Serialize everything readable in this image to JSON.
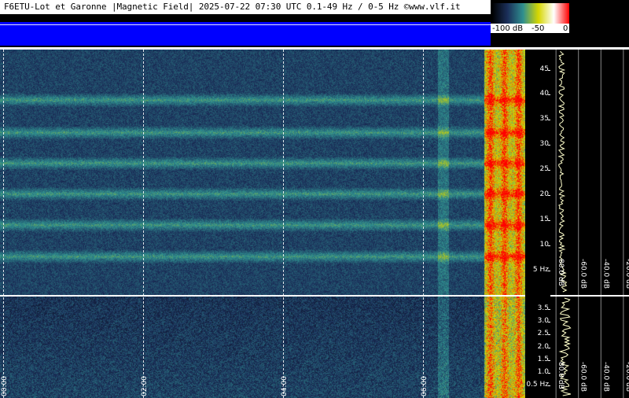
{
  "header": {
    "title": "F6ETU-Lot et Garonne |Magnetic Field| 2025-07-22 07:30 UTC 0.1-49 Hz / 0-5 Hz  ©www.vlf.it"
  },
  "legend": {
    "labels": [
      "-100 dB",
      "-50",
      "0"
    ],
    "colors": [
      "#000000",
      "#1b2f5a",
      "#2f8f8f",
      "#d7d700",
      "#ffffff",
      "#ff0000"
    ]
  },
  "chart_data": [
    {
      "type": "heatmap",
      "name_hint": "upper spectrogram",
      "y_ticks": [
        "5 Hz",
        "10",
        "15",
        "20",
        "25",
        "30",
        "35",
        "40",
        "45"
      ],
      "y_tick_values": [
        5,
        10,
        15,
        20,
        25,
        30,
        35,
        40,
        45
      ],
      "ylim": [
        0.1,
        49
      ],
      "x_time_ticks": [
        "00:00",
        "02:00",
        "04:00",
        "06:00"
      ],
      "x_time_values": [
        0,
        2,
        4,
        6
      ],
      "xlim_hours": [
        0,
        7.5
      ],
      "horizontal_bands_hz": [
        7.8,
        14.1,
        20.3,
        26.4,
        32.5,
        39
      ],
      "bright_columns_hours": [
        7.0,
        7.2,
        7.4
      ],
      "colormap": [
        "#000000",
        "#1b2f5a",
        "#2f8f8f",
        "#d7d700",
        "#ff0000"
      ]
    },
    {
      "type": "heatmap",
      "name_hint": "lower spectrogram",
      "y_ticks": [
        "0.5 Hz",
        "1.0",
        "1.5",
        "2.0",
        "2.5",
        "3.0",
        "3.5"
      ],
      "y_tick_values": [
        0.5,
        1.0,
        1.5,
        2.0,
        2.5,
        3.0,
        3.5
      ],
      "ylim": [
        0,
        4
      ],
      "x_time_ticks": [
        "00:00",
        "02:00",
        "04:00",
        "06:00"
      ],
      "x_time_values": [
        0,
        2,
        4,
        6
      ],
      "xlim_hours": [
        0,
        7.5
      ]
    },
    {
      "type": "line",
      "name_hint": "spectrum profiles",
      "db_ticks": [
        "80.0 dB",
        "-60.0 dB",
        "-40.0 dB",
        "-20.0 dB"
      ],
      "db_tick_values": [
        -80,
        -60,
        -40,
        -20
      ],
      "xlim_db": [
        -85,
        -15
      ]
    }
  ]
}
